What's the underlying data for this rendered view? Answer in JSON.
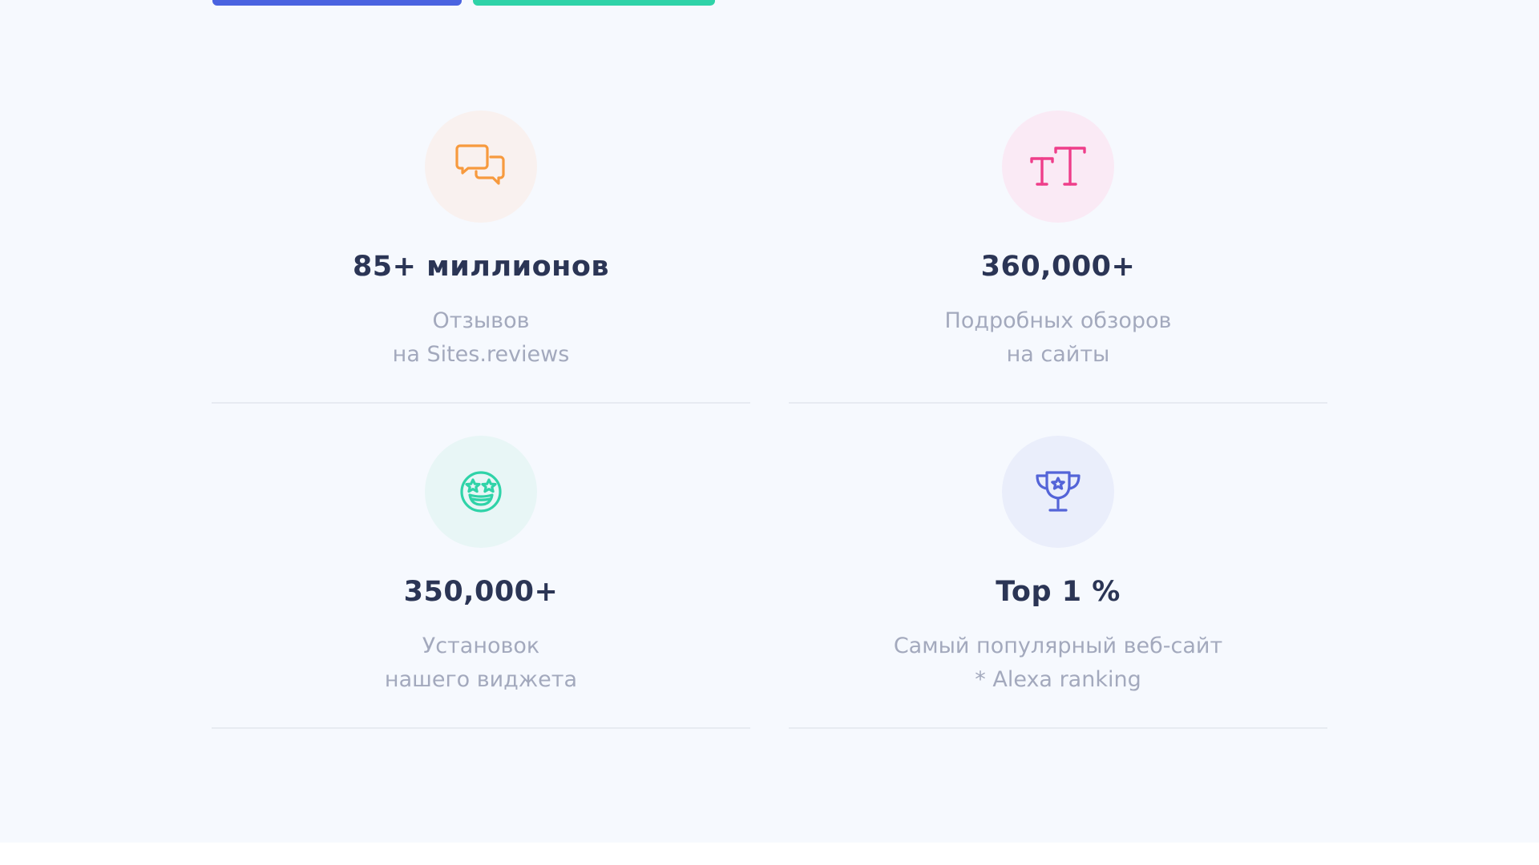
{
  "stats": [
    {
      "icon": "chat-bubbles-icon",
      "value": "85+ миллионов",
      "desc_line1": "Отзывов",
      "desc_line2": "на Sites.reviews",
      "icon_color": "#f79a3e",
      "circle_color": "#f9f1ef"
    },
    {
      "icon": "text-size-icon",
      "value": "360,000+",
      "desc_line1": "Подробных обзоров",
      "desc_line2": "на сайты",
      "icon_color": "#ee3e8a",
      "circle_color": "#faeaf5"
    },
    {
      "icon": "star-eyes-smiley-icon",
      "value": "350,000+",
      "desc_line1": "Установок",
      "desc_line2": "нашего виджета",
      "icon_color": "#2fd3a8",
      "circle_color": "#e8f6f6"
    },
    {
      "icon": "trophy-icon",
      "value": "Top 1 %",
      "desc_line1": "Самый популярный веб-сайт",
      "desc_line2": "* Alexa ranking",
      "icon_color": "#5464d8",
      "circle_color": "#eaeefb"
    }
  ]
}
